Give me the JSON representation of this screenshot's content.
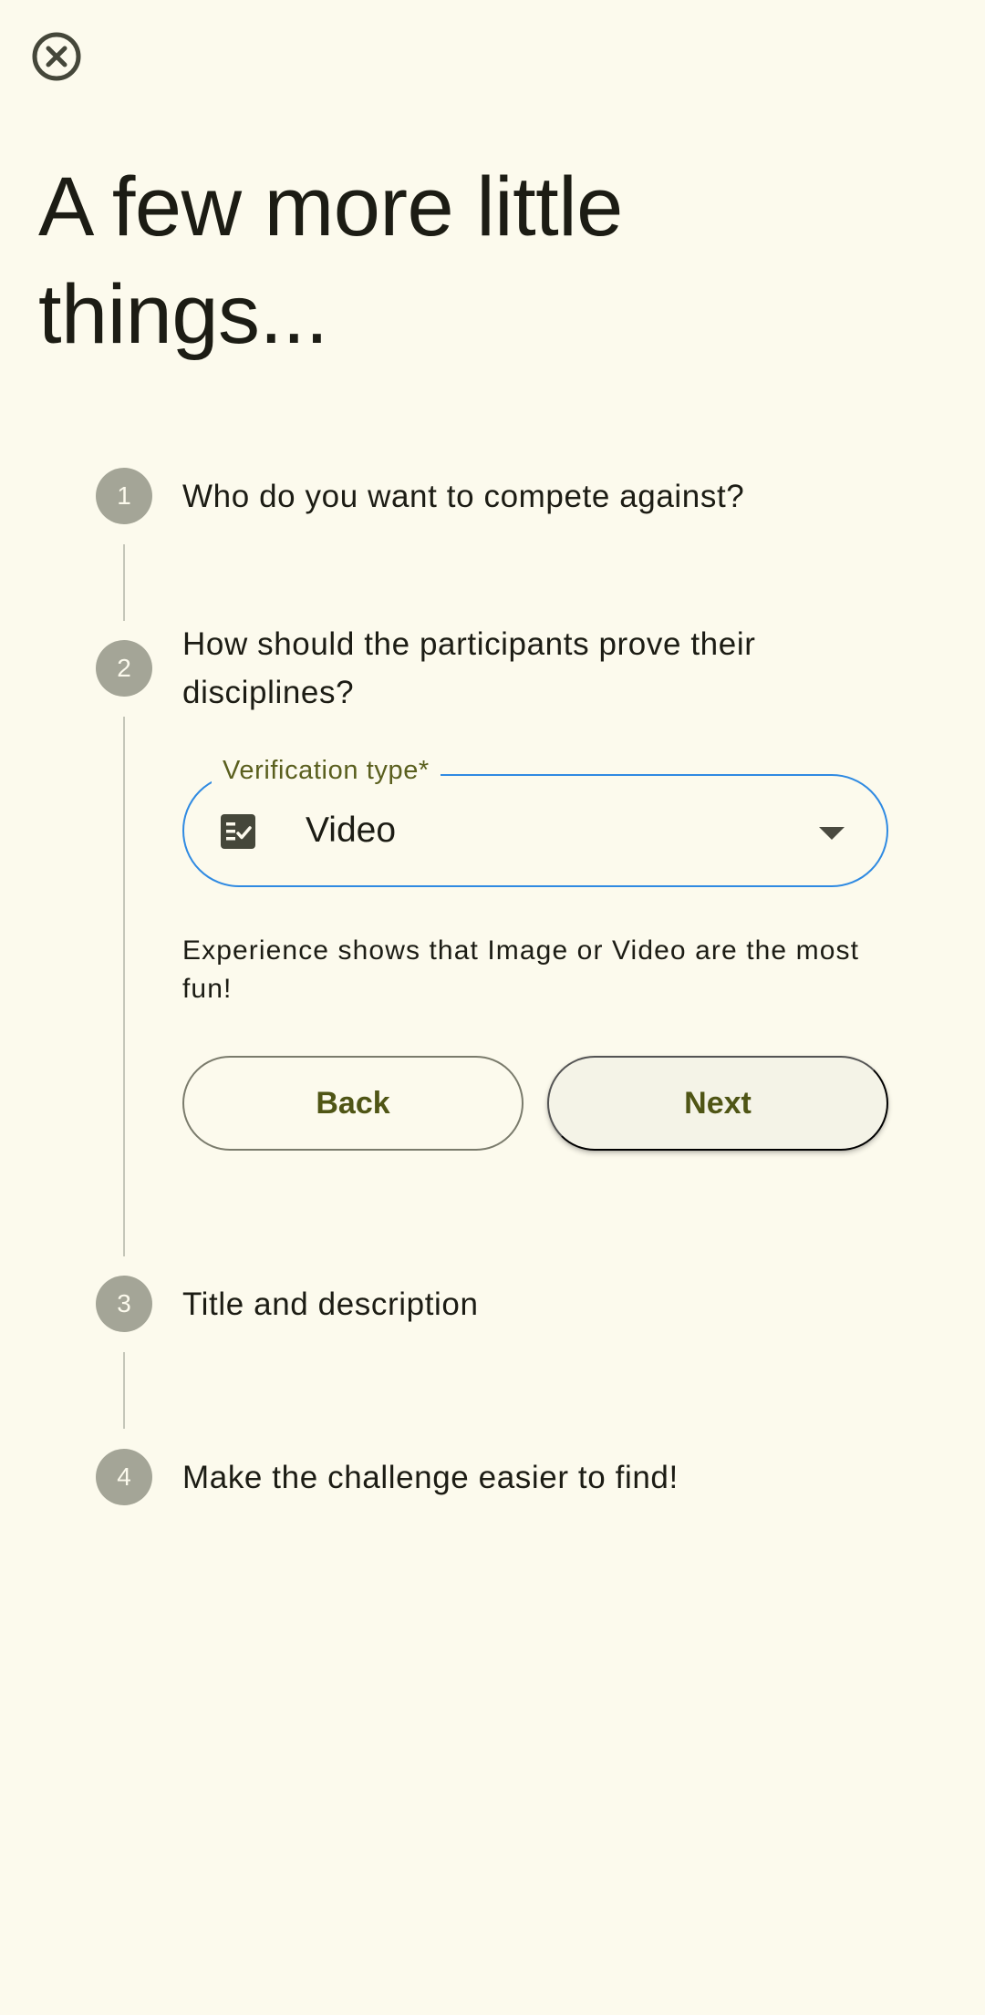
{
  "page": {
    "title": "A few more little things..."
  },
  "close_button": {
    "icon": "close-circle-icon"
  },
  "steps": [
    {
      "number": "1",
      "label": "Who do you want to compete against?"
    },
    {
      "number": "2",
      "label": "How should the participants prove their disciplines?"
    },
    {
      "number": "3",
      "label": "Title and description"
    },
    {
      "number": "4",
      "label": "Make the challenge easier to find!"
    }
  ],
  "verification_field": {
    "label": "Verification type*",
    "value": "Video",
    "icon": "fact-check-icon",
    "border_color": "#2f8ae2"
  },
  "helper_text": "Experience shows that Image or Video are the most fun!",
  "actions": {
    "back_label": "Back",
    "next_label": "Next"
  },
  "colors": {
    "background": "#fcfaed",
    "accent_text": "#4f5515",
    "step_circle": "#a4a597"
  }
}
